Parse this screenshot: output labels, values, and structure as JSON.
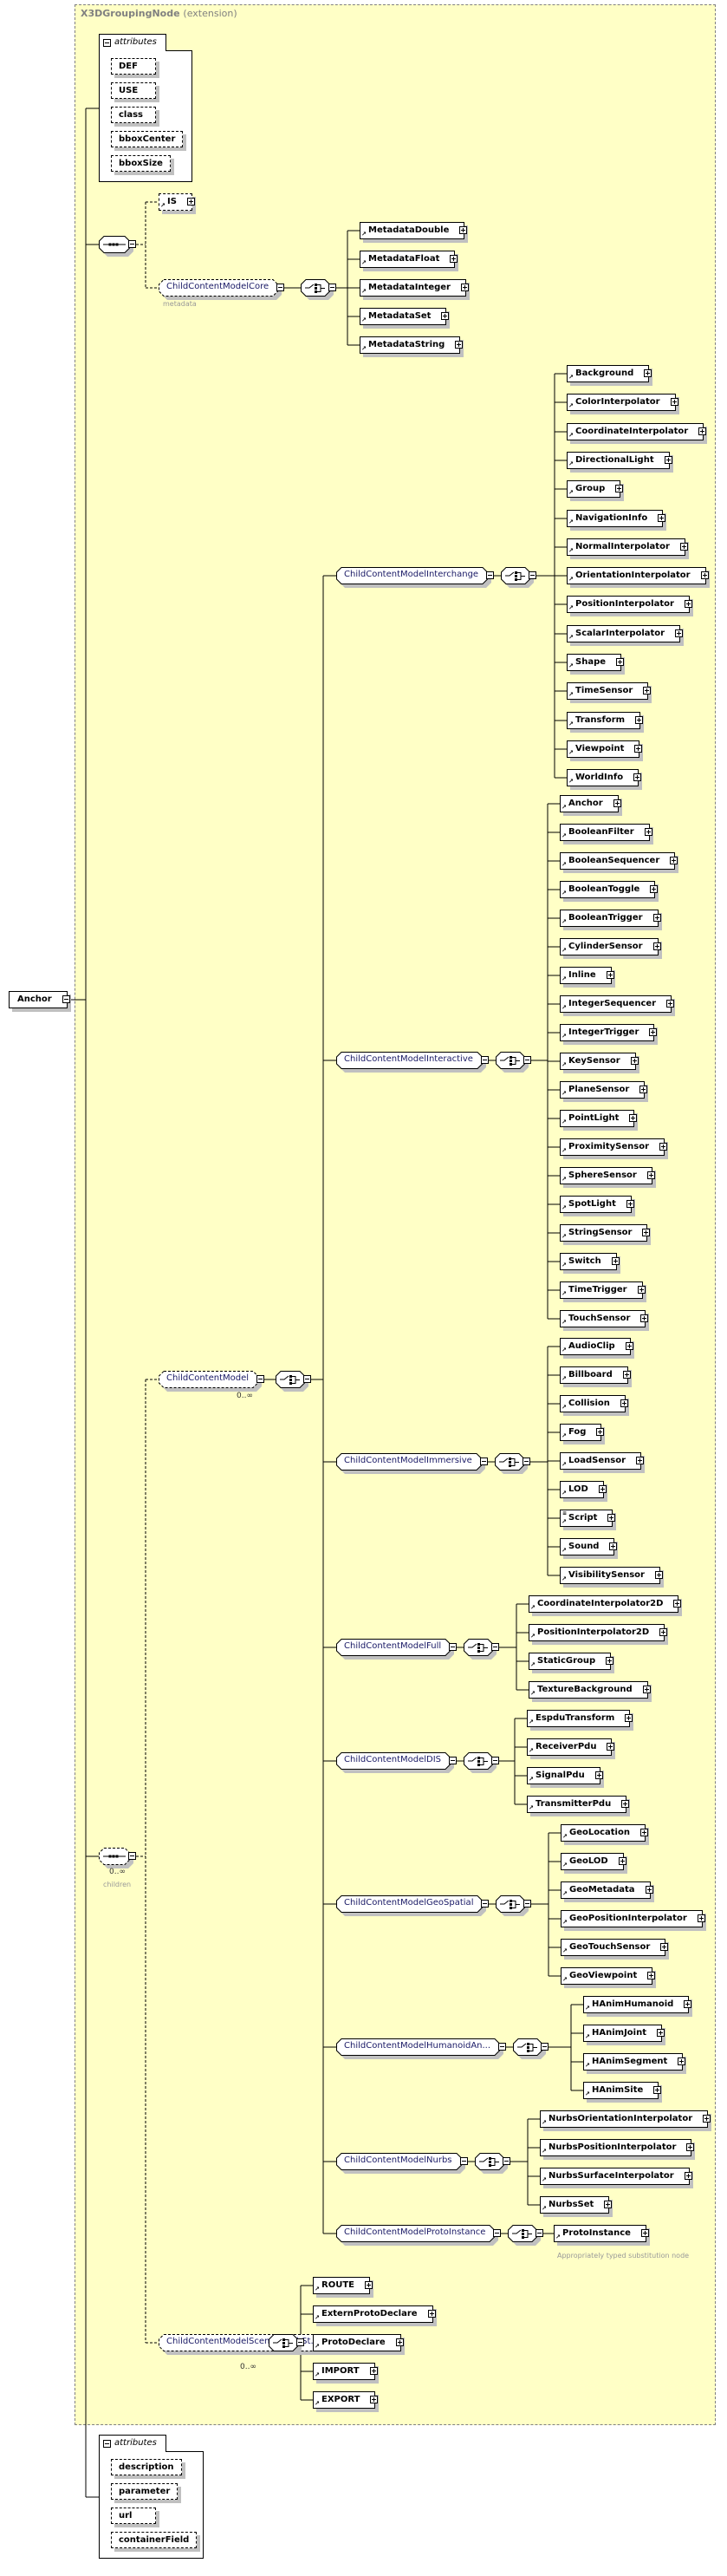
{
  "diagram": {
    "root": {
      "label": "Anchor"
    },
    "extension": {
      "base": "X3DGroupingNode",
      "qualifier": "(extension)"
    },
    "base_attributes": {
      "heading": "attributes",
      "items": [
        "DEF",
        "USE",
        "class",
        "bboxCenter",
        "bboxSize"
      ]
    },
    "sequence_1": {
      "is_element": "IS",
      "core_group": {
        "label": "ChildContentModelCore",
        "annotation": "metadata",
        "children": [
          "MetadataDouble",
          "MetadataFloat",
          "MetadataInteger",
          "MetadataSet",
          "MetadataString"
        ]
      }
    },
    "sequence_2": {
      "occurrence": "0..∞",
      "annotation": "children",
      "child_content_model": {
        "label": "ChildContentModel",
        "occurrence": "0..∞",
        "groups": [
          {
            "label": "ChildContentModelInterchange",
            "children": [
              "Background",
              "ColorInterpolator",
              "CoordinateInterpolator",
              "DirectionalLight",
              "Group",
              "NavigationInfo",
              "NormalInterpolator",
              "OrientationInterpolator",
              "PositionInterpolator",
              "ScalarInterpolator",
              "Shape",
              "TimeSensor",
              "Transform",
              "Viewpoint",
              "WorldInfo"
            ]
          },
          {
            "label": "ChildContentModelInteractive",
            "children": [
              "Anchor",
              "BooleanFilter",
              "BooleanSequencer",
              "BooleanToggle",
              "BooleanTrigger",
              "CylinderSensor",
              "Inline",
              "IntegerSequencer",
              "IntegerTrigger",
              "KeySensor",
              "PlaneSensor",
              "PointLight",
              "ProximitySensor",
              "SphereSensor",
              "SpotLight",
              "StringSensor",
              "Switch",
              "TimeTrigger",
              "TouchSensor"
            ]
          },
          {
            "label": "ChildContentModelImmersive",
            "children": [
              "AudioClip",
              "Billboard",
              "Collision",
              "Fog",
              "LoadSensor",
              "LOD",
              "Script",
              "Sound",
              "VisibilitySensor"
            ]
          },
          {
            "label": "ChildContentModelFull",
            "children": [
              "CoordinateInterpolator2D",
              "PositionInterpolator2D",
              "StaticGroup",
              "TextureBackground"
            ]
          },
          {
            "label": "ChildContentModelDIS",
            "children": [
              "EspduTransform",
              "ReceiverPdu",
              "SignalPdu",
              "TransmitterPdu"
            ]
          },
          {
            "label": "ChildContentModelGeoSpatial",
            "children": [
              "GeoLocation",
              "GeoLOD",
              "GeoMetadata",
              "GeoPositionInterpolator",
              "GeoTouchSensor",
              "GeoViewpoint"
            ]
          },
          {
            "label": "ChildContentModelHumanoidAn...",
            "children": [
              "HAnimHumanoid",
              "HAnimJoint",
              "HAnimSegment",
              "HAnimSite"
            ]
          },
          {
            "label": "ChildContentModelNurbs",
            "children": [
              "NurbsOrientationInterpolator",
              "NurbsPositionInterpolator",
              "NurbsSurfaceInterpolator",
              "NurbsSet"
            ]
          },
          {
            "label": "ChildContentModelProtoInstance",
            "children": [
              "ProtoInstance"
            ],
            "annotation": "Appropriately typed substitution node"
          }
        ]
      },
      "scene_graph_group": {
        "label": "ChildContentModelSceneGraphSt...",
        "occurrence": "0..∞",
        "children": [
          "ROUTE",
          "ExternProtoDeclare",
          "ProtoDeclare",
          "IMPORT",
          "EXPORT"
        ]
      }
    },
    "own_attributes": {
      "heading": "attributes",
      "items": [
        "description",
        "parameter",
        "url",
        "containerField"
      ]
    }
  }
}
